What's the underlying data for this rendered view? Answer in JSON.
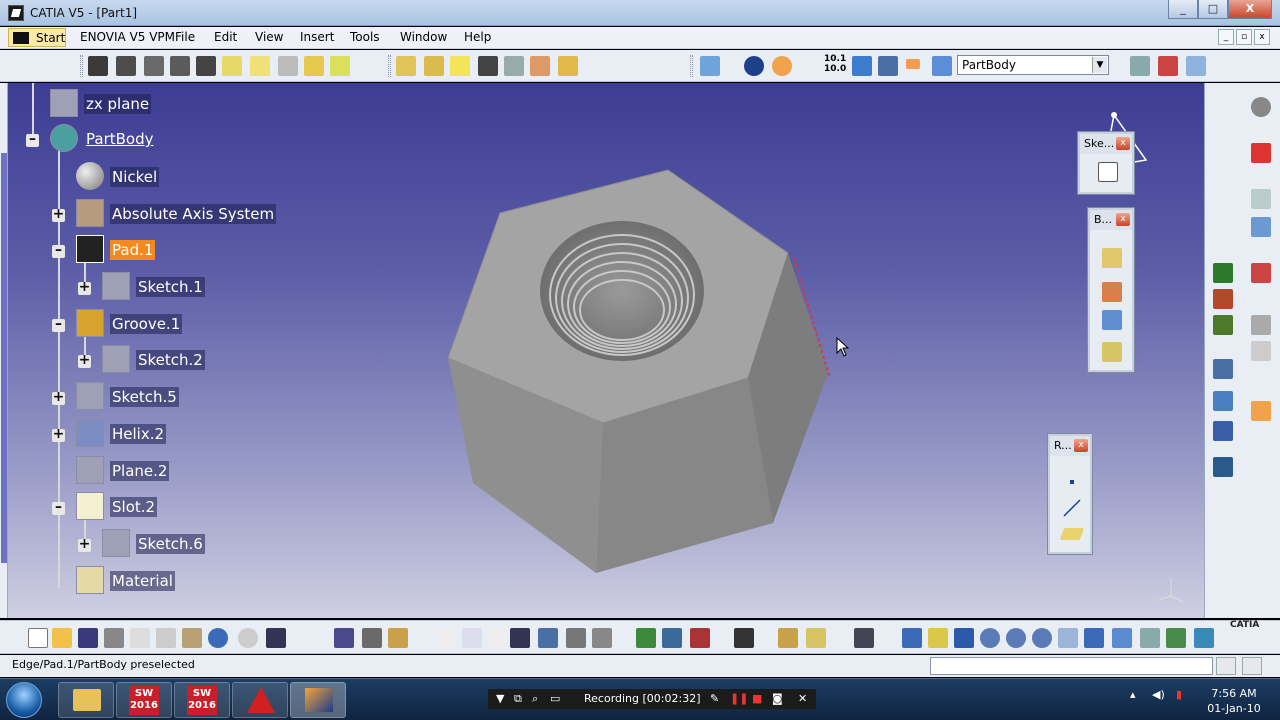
{
  "window": {
    "title": "CATIA V5 - [Part1]",
    "buttons": [
      "_",
      "□",
      "X"
    ]
  },
  "menu": {
    "items": [
      "Start",
      "ENOVIA V5 VPM",
      "File",
      "Edit",
      "View",
      "Insert",
      "Tools",
      "Window",
      "Help"
    ]
  },
  "toolbar": {
    "body_selector": "PartBody",
    "measure_values": [
      "10.1",
      "10.0"
    ]
  },
  "tree": {
    "nodes": [
      {
        "label": "zx plane",
        "icon": "plane-icon"
      },
      {
        "label": "PartBody",
        "icon": "partbody-gear-icon"
      },
      {
        "label": "Nickel",
        "icon": "material-sphere-icon"
      },
      {
        "label": "Absolute Axis System",
        "icon": "axis-system-icon"
      },
      {
        "label": "Pad.1",
        "icon": "pad-icon"
      },
      {
        "label": "Sketch.1",
        "icon": "sketch-icon"
      },
      {
        "label": "Groove.1",
        "icon": "groove-icon"
      },
      {
        "label": "Sketch.2",
        "icon": "sketch-icon"
      },
      {
        "label": "Sketch.5",
        "icon": "sketch-icon"
      },
      {
        "label": "Helix.2",
        "icon": "helix-icon"
      },
      {
        "label": "Plane.2",
        "icon": "plane-icon"
      },
      {
        "label": "Slot.2",
        "icon": "slot-icon"
      },
      {
        "label": "Sketch.6",
        "icon": "sketch-icon"
      },
      {
        "label": "Material",
        "icon": "material-box-icon"
      }
    ]
  },
  "palettes": {
    "sketcher": "Ske...",
    "boolean": "B...",
    "reference": "R..."
  },
  "status": {
    "text": "Edge/Pad.1/PartBody preselected"
  },
  "recorder": {
    "text": "Recording [00:02:32]"
  },
  "taskbar": {
    "sw_label": "SW",
    "sw_year": "2016"
  },
  "clock": {
    "time": "7:56 AM",
    "date": "01-Jan-10"
  },
  "brand": {
    "catia": "CATIA"
  }
}
